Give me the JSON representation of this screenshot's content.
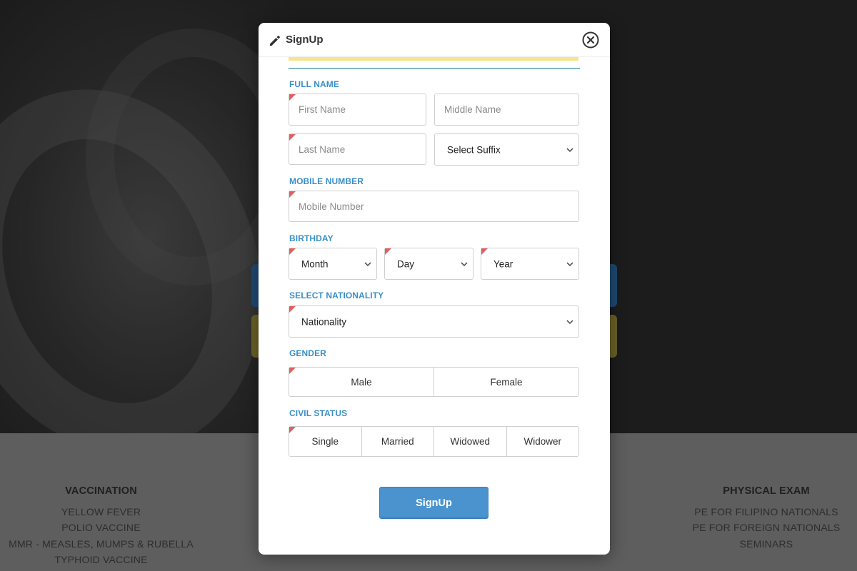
{
  "modal": {
    "title": "SignUp",
    "submit_label": "SignUp"
  },
  "sections": {
    "full_name": "FULL NAME",
    "mobile_number": "MOBILE NUMBER",
    "birthday": "BIRTHDAY",
    "nationality": "SELECT NATIONALITY",
    "gender": "GENDER",
    "civil_status": "CIVIL STATUS"
  },
  "fields": {
    "first_name_placeholder": "First Name",
    "middle_name_placeholder": "Middle Name",
    "last_name_placeholder": "Last Name",
    "suffix_selected": "Select Suffix",
    "mobile_placeholder": "Mobile Number",
    "month_selected": "Month",
    "day_selected": "Day",
    "year_selected": "Year",
    "nationality_selected": "Nationality"
  },
  "gender_options": [
    "Male",
    "Female"
  ],
  "civil_status_options": [
    "Single",
    "Married",
    "Widowed",
    "Widower"
  ],
  "footer": {
    "vaccination": {
      "heading": "VACCINATION",
      "items": [
        "YELLOW FEVER",
        "POLIO VACCINE",
        "MMR - MEASLES, MUMPS & RUBELLA",
        "TYPHOID VACCINE"
      ]
    },
    "physical_exam": {
      "heading": "PHYSICAL EXAM",
      "items": [
        "PE FOR FILIPINO NATIONALS",
        "PE FOR FOREIGN NATIONALS",
        "SEMINARS"
      ]
    }
  },
  "icons": {
    "title_icon": "pencil-icon",
    "close": "close-icon",
    "dropdown": "chevron-down-icon"
  },
  "colors": {
    "accent": "#4a93cf",
    "section_label": "#3a8fc6",
    "required_marker": "#e06060"
  }
}
